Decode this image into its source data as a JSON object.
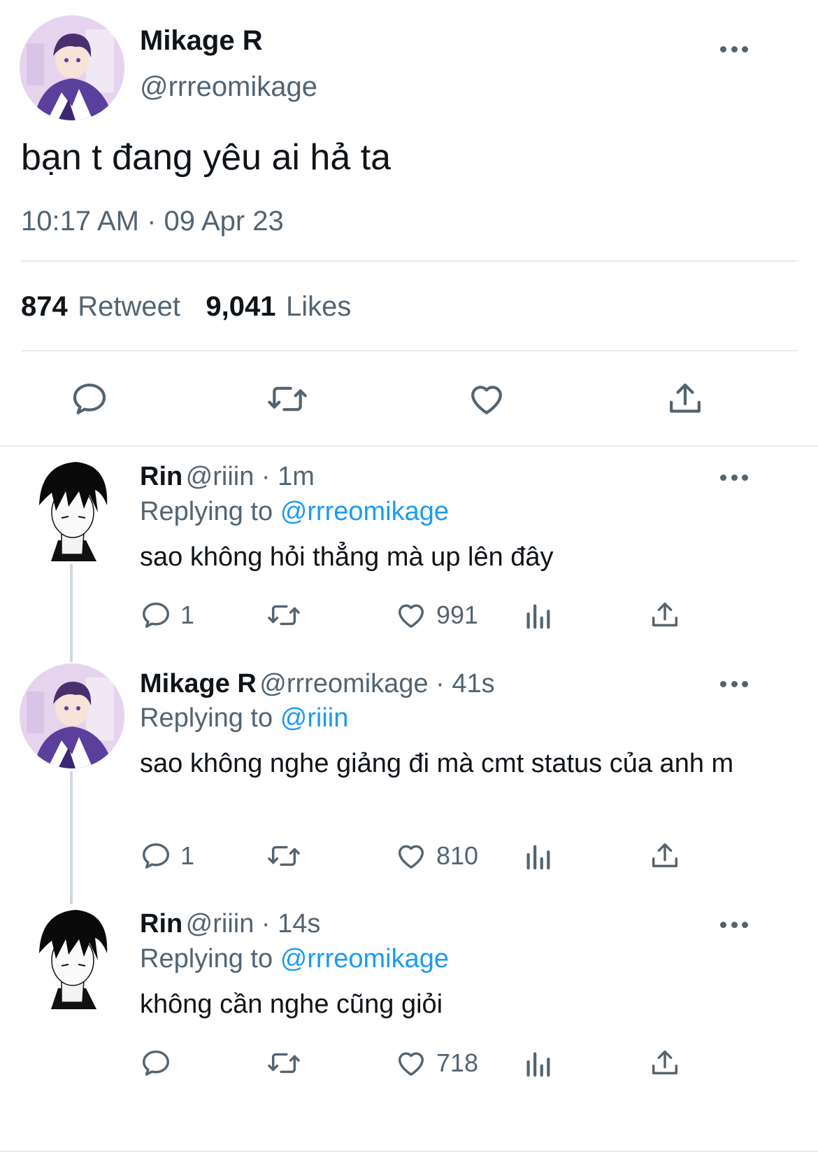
{
  "main_tweet": {
    "author_name": "Mikage R",
    "author_handle": "@rrreomikage",
    "text": "bạn t đang yêu ai hả ta",
    "timestamp": "10:17 AM · 09 Apr 23",
    "retweet_count": "874",
    "retweet_label": "Retweet",
    "likes_count": "9,041",
    "likes_label": "Likes"
  },
  "replies": [
    {
      "author_name": "Rin",
      "meta": "@riiin · 1m",
      "replying_label": "Replying to",
      "replying_to": "@rrreomikage",
      "text": "sao không hỏi thẳng mà up lên đây",
      "reply_count": "1",
      "like_count": "991"
    },
    {
      "author_name": "Mikage R",
      "meta": "@rrreomikage · 41s",
      "replying_label": "Replying to",
      "replying_to": "@riiin",
      "text": "sao không nghe giảng đi mà cmt status của anh m",
      "reply_count": "1",
      "like_count": "810"
    },
    {
      "author_name": "Rin",
      "meta": "@riiin · 14s",
      "replying_label": "Replying to",
      "replying_to": "@rrreomikage",
      "text": "không cần nghe cũng giỏi",
      "reply_count": "",
      "like_count": "718"
    }
  ],
  "icons": {
    "reply": "speech-bubble-icon",
    "retweet": "retweet-arrows-icon",
    "like": "heart-icon",
    "views": "bar-chart-icon",
    "share": "share-upload-icon",
    "more": "ellipsis-icon"
  },
  "colors": {
    "text_primary": "#0f1419",
    "text_secondary": "#536471",
    "mention_blue": "#1d9bf0",
    "divider": "#e7e9ea"
  }
}
